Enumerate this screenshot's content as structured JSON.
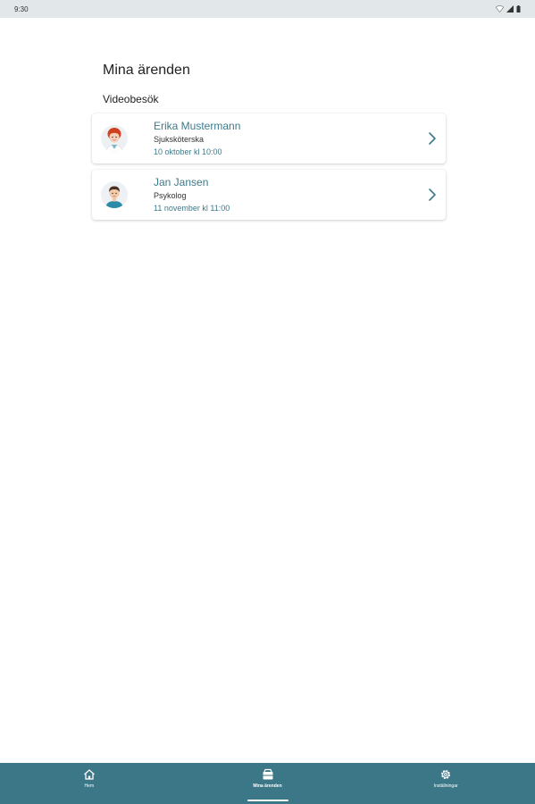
{
  "status_bar": {
    "time": "9:30"
  },
  "page": {
    "title": "Mina ärenden",
    "section_title": "Videobesök"
  },
  "appointments": [
    {
      "name": "Erika Mustermann",
      "role": "Sjuksköterska",
      "date": "10 oktober kl 10:00",
      "avatar_icon": "female-avatar-icon"
    },
    {
      "name": "Jan Jansen",
      "role": "Psykolog",
      "date": "11 november kl 11:00",
      "avatar_icon": "male-avatar-icon"
    }
  ],
  "nav": {
    "home_label": "Hem",
    "cases_label": "Mina ärenden",
    "settings_label": "Inställningar",
    "active": "cases"
  },
  "colors": {
    "accent": "#3c7787",
    "link_text": "#3d7a8a",
    "status_bar": "#e2e7e9"
  }
}
